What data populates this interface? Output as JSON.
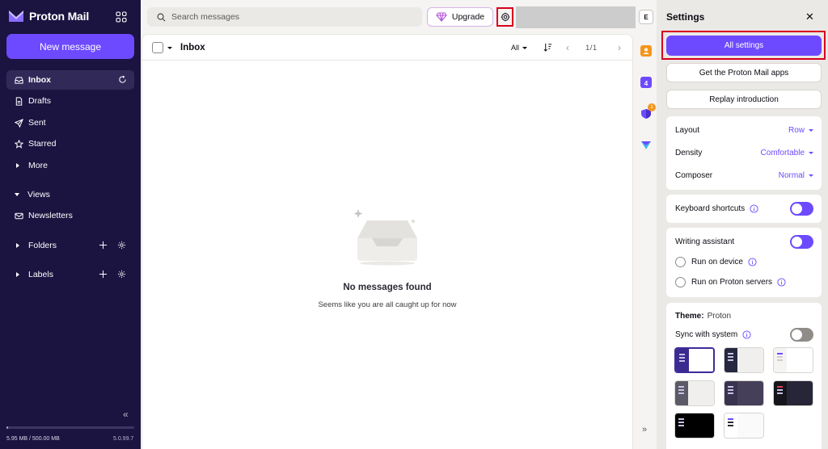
{
  "sidebar": {
    "brand": "Proton Mail",
    "new_message": "New message",
    "items": [
      {
        "label": "Inbox"
      },
      {
        "label": "Drafts"
      },
      {
        "label": "Sent"
      },
      {
        "label": "Starred"
      },
      {
        "label": "More"
      },
      {
        "label": "Views"
      },
      {
        "label": "Newsletters"
      },
      {
        "label": "Folders"
      },
      {
        "label": "Labels"
      }
    ],
    "storage": "5.95 MB / 500.00 MB",
    "storage_fraction": 0.012,
    "version": "5.0.99.7"
  },
  "topbar": {
    "search_placeholder": "Search messages",
    "upgrade": "Upgrade"
  },
  "mailbox": {
    "title": "Inbox",
    "filter": "All",
    "pager": "1/1",
    "empty_title": "No messages found",
    "empty_subtitle": "Seems like you are all caught up for now"
  },
  "rail": {
    "account_initial": "E",
    "calendar_day": "4",
    "vpn_badge": "1"
  },
  "settings": {
    "title": "Settings",
    "all_settings": "All settings",
    "get_apps": "Get the Proton Mail apps",
    "replay_intro": "Replay introduction",
    "layout_label": "Layout",
    "layout_value": "Row",
    "density_label": "Density",
    "density_value": "Comfortable",
    "composer_label": "Composer",
    "composer_value": "Normal",
    "keyboard_shortcuts": "Keyboard shortcuts",
    "keyboard_shortcuts_on": true,
    "writing_assistant": "Writing assistant",
    "writing_assistant_on": true,
    "run_on_device": "Run on device",
    "run_on_servers": "Run on Proton servers",
    "theme_label": "Theme:",
    "theme_value": "Proton",
    "sync_with_system": "Sync with system",
    "sync_on": false
  },
  "colors": {
    "accent": "#6d4aff",
    "sidebar": "#1b1340",
    "highlight": "#d7001f"
  }
}
